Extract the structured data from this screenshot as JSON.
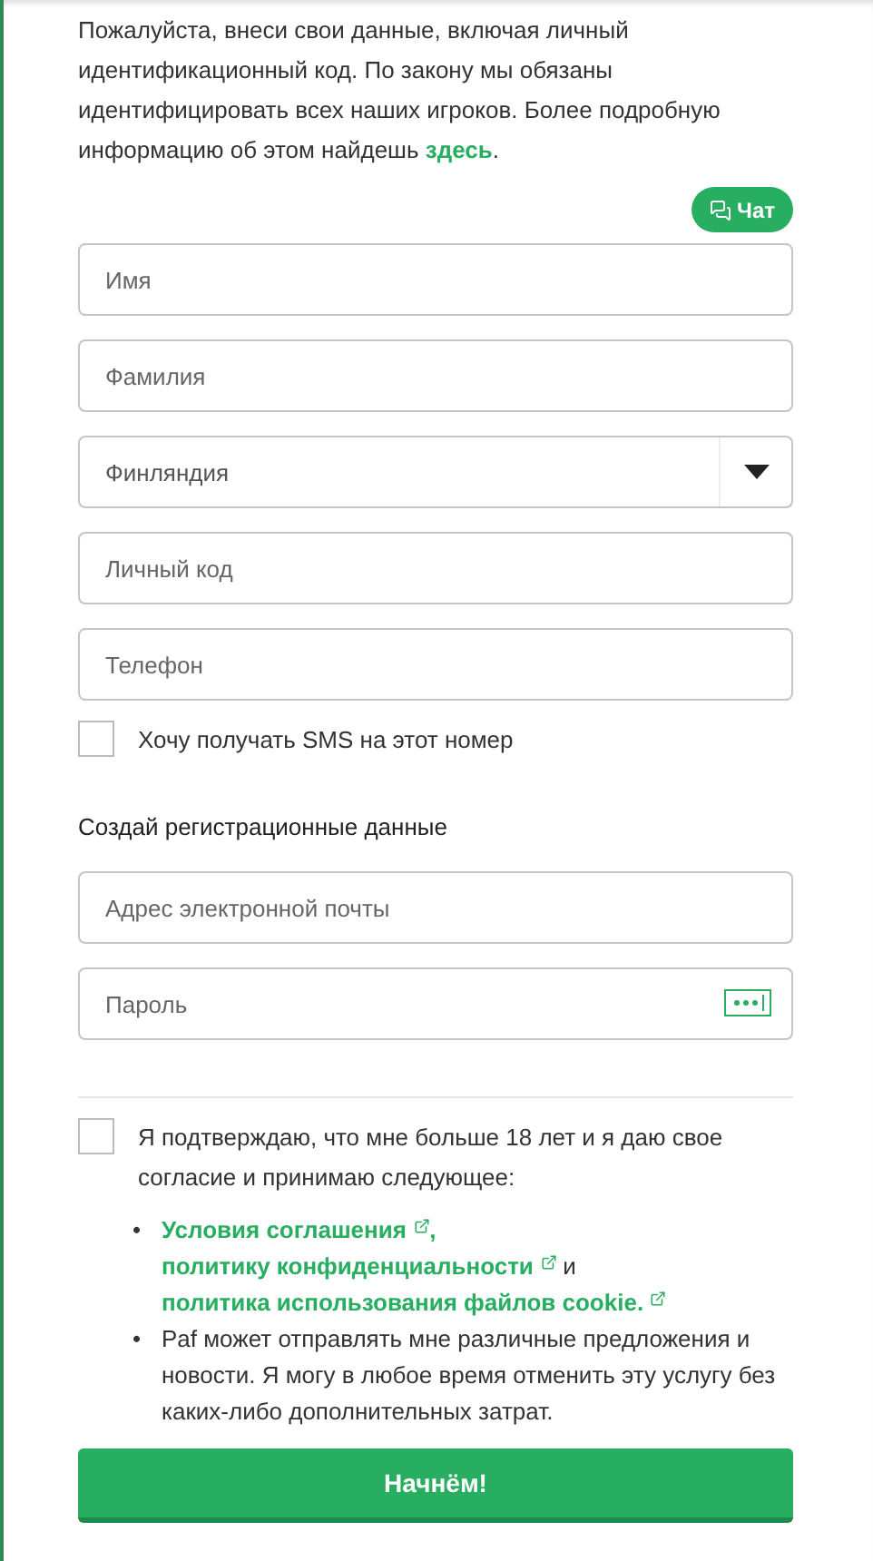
{
  "intro": {
    "text": "Пожалуйста, внеси свои данные, включая личный идентификационный код. По закону мы обязаны идентифицировать всех наших игроков. Более подробную информацию об этом найдешь ",
    "link": "здесь",
    "after": "."
  },
  "chat": {
    "label": "Чат"
  },
  "personal_fields": [
    {
      "kind": "text",
      "placeholder": "Имя"
    },
    {
      "kind": "text",
      "placeholder": "Фамилия"
    },
    {
      "kind": "select",
      "value": "Финляндия"
    },
    {
      "kind": "text",
      "placeholder": "Личный код"
    },
    {
      "kind": "text",
      "placeholder": "Телефон"
    }
  ],
  "sms": {
    "label": "Хочу получать SMS на этот номер",
    "checked": false
  },
  "credentials_heading": "Создай регистрационные данные",
  "credential_fields": [
    {
      "kind": "text",
      "placeholder": "Адрес электронной почты"
    },
    {
      "kind": "password",
      "placeholder": "Пароль"
    }
  ],
  "consent": {
    "label": "Я подтверждаю, что мне больше 18 лет и я даю свое согласие и принимаю следующее:",
    "checked": false
  },
  "bullets": [
    {
      "marker": "•",
      "segments": [
        {
          "kind": "link",
          "text": "Условия соглашения"
        },
        {
          "kind": "text",
          "text": ", "
        },
        {
          "kind": "link",
          "text": "политику конфиденциальности"
        },
        {
          "kind": "plain",
          "text": " и "
        },
        {
          "kind": "link",
          "text": "политика использования файлов cookie."
        }
      ]
    },
    {
      "marker": "•",
      "segments": [
        {
          "kind": "plain",
          "text": "Paf может отправлять мне различные предложения и новости. Я могу в любое время отменить эту услугу без каких-либо дополнительных затрат."
        }
      ]
    }
  ],
  "submit": {
    "label": "Начнём!"
  }
}
